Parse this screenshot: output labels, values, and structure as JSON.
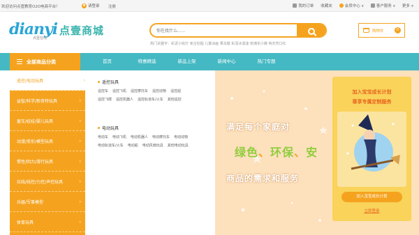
{
  "topbar": {
    "welcome": "欢迎访问点壹教育O2O电商平台！",
    "login": "请登录",
    "register": "注册",
    "right": [
      {
        "label": "我的订单",
        "icon": "order-icon"
      },
      {
        "label": "收藏夹",
        "icon": ""
      },
      {
        "label": "会员中心",
        "icon": "member-icon"
      },
      {
        "label": "客户服务",
        "icon": "service-icon"
      },
      {
        "label": "更多",
        "icon": ""
      }
    ]
  },
  "logo": {
    "main": "dianyi",
    "sub": "点壹在线",
    "slogan": "点壹商城"
  },
  "search": {
    "placeholder": "你在找什么......",
    "hotwords": "热门关键字：彩泥小收灯  考古挖掘  儿童涂画  果冻蜡  彩泥冰淇凌  玫瑰花小鲢  纯天然口红"
  },
  "cart": {
    "label": "购物车",
    "count": "0"
  },
  "nav": {
    "all_categories": "全部商品分类",
    "items": [
      "首页",
      "特惠精选",
      "新品上架",
      "新闻中心",
      "热门专题"
    ]
  },
  "sidebar": [
    "遥控/电动玩具",
    "益智/科学/新奇特玩具",
    "童车/娃娃/婴儿玩具",
    "动漫/变形/模型玩具",
    "惯性/回力/滑行玩具",
    "拉线/线控/力控/声控玩具",
    "兵器/军事模型",
    "体育玩具"
  ],
  "dropdown": {
    "groups": [
      {
        "title": "遥控玩具",
        "rows": [
          [
            "遥控车",
            "遥控飞机",
            "遥控摩托车",
            "遥控动物",
            "遥控船"
          ],
          [
            "遥控飞碟",
            "遥控机器人",
            "遥控轨道车/火车",
            "其他遥控"
          ]
        ]
      },
      {
        "title": "电动玩具",
        "rows": [
          [
            "电动车",
            "电动飞机",
            "电动机器人",
            "电动摩托车",
            "电动动物"
          ],
          [
            "电动轨道车/火车",
            "电动船",
            "电动风扇玩具",
            "其他电动玩具"
          ]
        ]
      }
    ]
  },
  "banner": {
    "line1": "满足每个家庭对",
    "line2a": "绿色",
    "line2b": "、",
    "line2c": "环保",
    "line2d": "、",
    "line2e": "安",
    "line3": "商品的需求和服务"
  },
  "promo": {
    "title1": "加入宝宝成长计划",
    "title2": "尊享专属定制服务",
    "button": "加入宝宝成长计划",
    "link": "立即登录"
  },
  "colors": {
    "accent": "#f5a31f",
    "nav": "#44b9c3",
    "banner": "#fde0bc"
  }
}
